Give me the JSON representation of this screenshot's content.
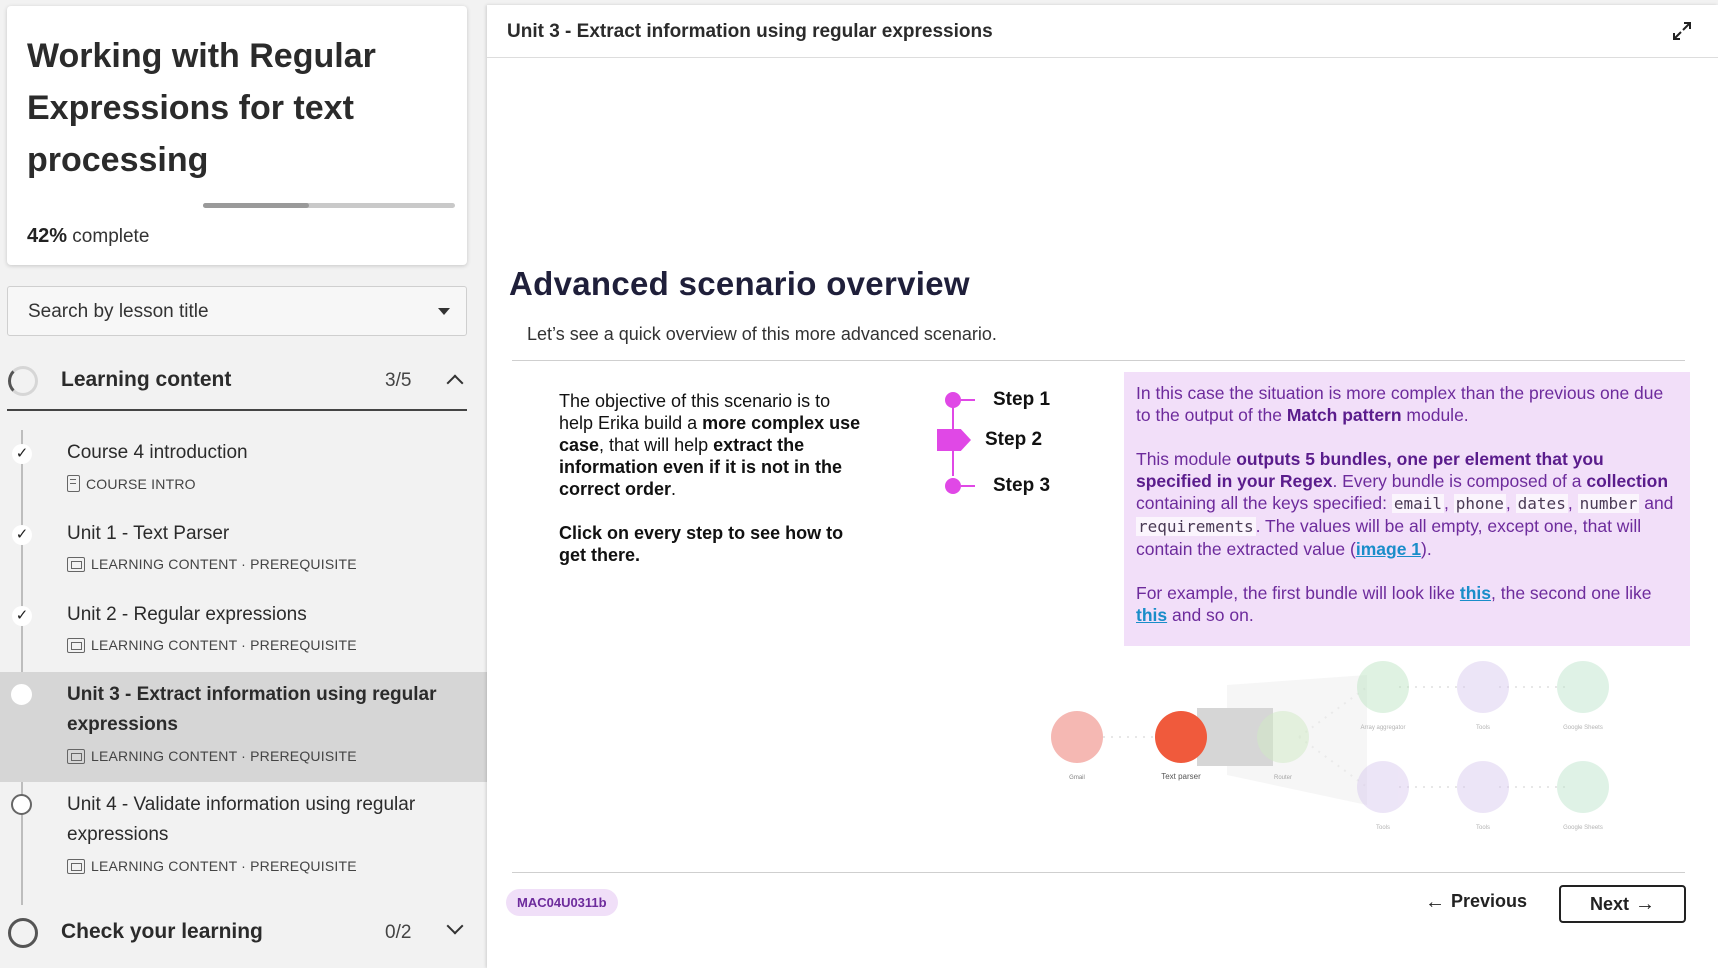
{
  "sidebar": {
    "course_title": "Working with Regular Expressions for text processing",
    "progress_percent": "42%",
    "progress_suffix": " complete",
    "progress_fraction": 0.42,
    "search": {
      "placeholder": "Search by lesson title"
    },
    "sections": [
      {
        "title": "Learning content",
        "count": "3/5",
        "expanded": true,
        "lessons": [
          {
            "title": "Course 4 introduction",
            "meta": "COURSE INTRO",
            "status": "complete",
            "icon": "document-icon"
          },
          {
            "title": "Unit 1 - Text Parser",
            "meta": "LEARNING CONTENT · PREREQUISITE",
            "status": "complete",
            "icon": "media-icon"
          },
          {
            "title": "Unit 2 - Regular expressions",
            "meta": "LEARNING CONTENT · PREREQUISITE",
            "status": "complete",
            "icon": "media-icon"
          },
          {
            "title": "Unit 3 - Extract information using regular expressions",
            "meta": "LEARNING CONTENT · PREREQUISITE",
            "status": "current",
            "icon": "media-icon"
          },
          {
            "title": "Unit 4 - Validate information using regular expressions",
            "meta": "LEARNING CONTENT · PREREQUISITE",
            "status": "not-started",
            "icon": "media-icon"
          }
        ]
      },
      {
        "title": "Check your learning",
        "count": "0/2",
        "expanded": false
      }
    ]
  },
  "main": {
    "unit_title": "Unit 3 - Extract information using regular expressions",
    "heading": "Advanced scenario overview",
    "intro": "Let’s see a quick overview of this more advanced scenario.",
    "objective": {
      "p1_a": "The objective of this scenario is to help Erika build a ",
      "p1_b": "more complex use case",
      "p1_c": ", that will help ",
      "p1_d": "extract the information even if it is not in the correct order",
      "p1_e": ".",
      "p2": "Click on every step to see how to get there."
    },
    "steps": [
      "Step 1",
      "Step 2",
      "Step 3"
    ],
    "info": {
      "p1_a": "In this case the situation is more complex than the previous one due to the output of the ",
      "p1_b": "Match pattern",
      "p1_c": " module.",
      "p2_a": "This module ",
      "p2_b": "outputs 5 bundles",
      "p2_c": ", ",
      "p2_d": "one per element that you specified in your Regex",
      "p2_e": ". Every bundle is composed of a ",
      "p2_f": "collection",
      "p2_g": " containing all the keys specified: ",
      "code_email": "email",
      "code_phone": "phone",
      "code_dates": "dates",
      "code_number": "number",
      "and": " and ",
      "code_requirements": "requirements",
      "p2_h": ". The values will be all empty, except one, that will contain the extracted value (",
      "link_image": "image 1",
      "p2_i": ").",
      "p3_a": "For example, the first bundle will look like ",
      "link_this1": "this",
      "p3_b": ", the second one like ",
      "link_this2": "this",
      "p3_c": " and so on."
    },
    "diagram": {
      "modules": [
        {
          "label": "Gmail",
          "color": "#f2a09a"
        },
        {
          "label": "Text parser",
          "color": "#f05a3c"
        },
        {
          "label": "Router",
          "color": "#cfe9c4"
        },
        {
          "label": "Array aggregator",
          "color": "#b9e3bf"
        },
        {
          "label": "Tools",
          "color": "#d7c6ee"
        },
        {
          "label": "Google Sheets",
          "color": "#b9e3c9"
        },
        {
          "label": "Tools",
          "color": "#d7c6ee"
        },
        {
          "label": "Tools",
          "color": "#d7c6ee"
        },
        {
          "label": "Google Sheets",
          "color": "#b9e3c9"
        }
      ]
    },
    "footer": {
      "badge": "MAC04U0311b",
      "previous": "Previous",
      "next": "Next"
    }
  },
  "colors": {
    "accent_magenta": "#e048e6",
    "info_bg": "#f2dff9",
    "info_text": "#6d2b9c",
    "link": "#1a8dc9"
  }
}
